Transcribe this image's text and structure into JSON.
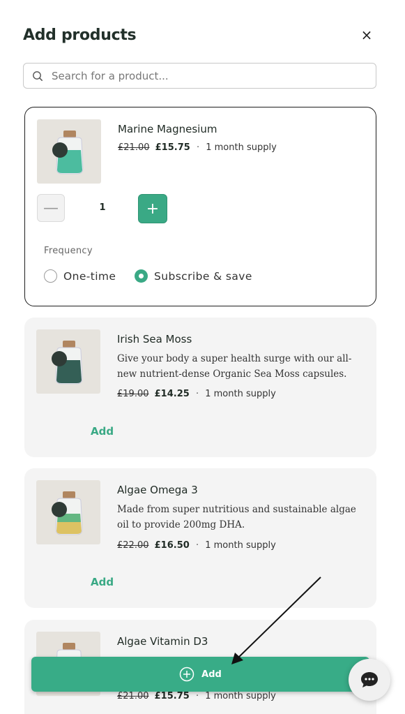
{
  "header": {
    "title": "Add products",
    "close_icon": "close-icon"
  },
  "search": {
    "placeholder": "Search for a product..."
  },
  "selected_product": {
    "name": "Marine Magnesium",
    "old_price": "£21.00",
    "new_price": "£15.75",
    "separator": "·",
    "supply": "1 month supply",
    "quantity": "1",
    "frequency_label": "Frequency",
    "options": [
      {
        "label": "One-time",
        "checked": false
      },
      {
        "label": "Subscribe & save",
        "checked": true
      }
    ]
  },
  "products": [
    {
      "name": "Irish Sea Moss",
      "description": "Give your body a super health surge with our all-new nutrient-dense Organic Sea Moss capsules.",
      "old_price": "£19.00",
      "new_price": "£14.25",
      "separator": "·",
      "supply": "1 month supply",
      "add_label": "Add"
    },
    {
      "name": "Algae Omega 3",
      "description": "Made from super nutritious and sustainable algae oil to provide 200mg DHA.",
      "old_price": "£22.00",
      "new_price": "£16.50",
      "separator": "·",
      "supply": "1 month supply",
      "add_label": "Add"
    },
    {
      "name": "Algae Vitamin D3",
      "old_price": "£21.00",
      "new_price": "£15.75",
      "separator": "·",
      "supply": "1 month supply"
    }
  ],
  "footer": {
    "add_button_label": "Add",
    "chat_icon": "chat-icon"
  },
  "colors": {
    "accent": "#3aa985",
    "card_bg": "#f4f4f4",
    "text": "#1f2a24"
  }
}
